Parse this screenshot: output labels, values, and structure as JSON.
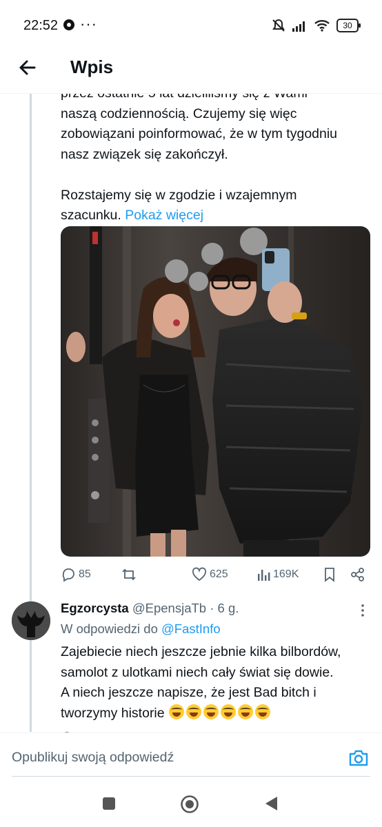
{
  "status_bar": {
    "time": "22:52",
    "more_dots": "···",
    "battery": "30",
    "icons": [
      "soccer-ball-icon",
      "mute-icon",
      "signal-icon",
      "wifi-icon",
      "battery-icon"
    ]
  },
  "header": {
    "title": "Wpis",
    "back_icon": "arrow-left-icon"
  },
  "tweet": {
    "text_line_partial": "przez ostatnie 5 lat dzieliliśmy się z Wami",
    "text_lines": [
      "naszą codziennością. Czujemy się więc",
      "zobowiązani poinformować, że w tym tygodniu",
      "nasz związek się zakończył."
    ],
    "para2_line1": "Rozstajemy się w zgodzie i wzajemnym",
    "para2_line2": "szacunku.",
    "show_more": "Pokaż więcej",
    "photo_alt": "couple-mirror-selfie-photo",
    "stats": {
      "replies": "85",
      "retweets": "",
      "likes": "625",
      "views": "169K"
    }
  },
  "reply": {
    "name": "Egzorcysta",
    "handle": "@EpensjaTb",
    "sep": "·",
    "time": "6 g.",
    "reply_to_label": "W odpowiedzi do",
    "reply_to_handle": "@FastInfo",
    "lines": [
      "Zajebiecie niech jeszcze jebnie kilka bilbordów,",
      "samolot z ulotkami niech cały świat się dowie.",
      "A niech jeszcze napisze, że jest Bad bitch i",
      "tworzymy historie"
    ],
    "emoji_count": 6,
    "emoji_name": "rolling-on-floor-laughing"
  },
  "compose": {
    "placeholder": "Opublikuj swoją odpowiedź"
  },
  "colors": {
    "accent": "#1d9bf0",
    "text": "#0f1419",
    "secondary": "#536471",
    "divider": "#cfd9de"
  }
}
